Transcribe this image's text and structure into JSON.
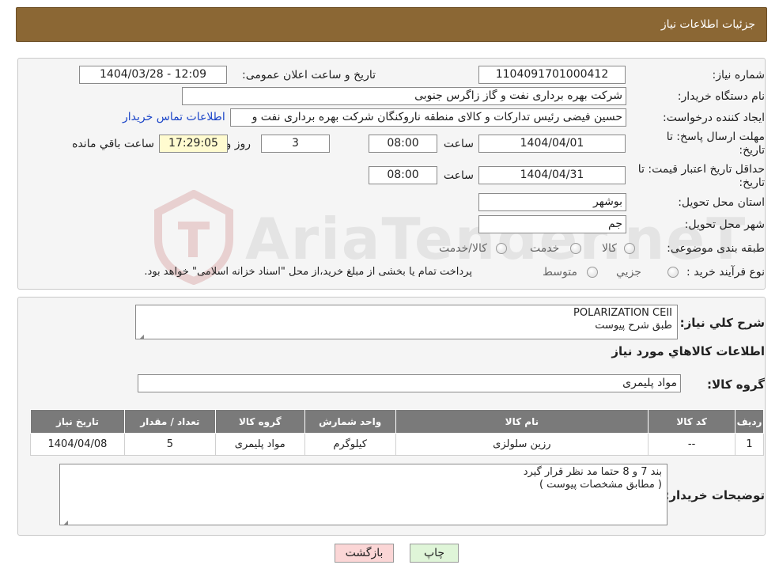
{
  "header": {
    "title": "جزئیات اطلاعات نیاز"
  },
  "fields": {
    "need_number_label": "شماره نیاز:",
    "need_number": "1104091701000412",
    "announce_label": "تاریخ و ساعت اعلان عمومی:",
    "announce_value": "1404/03/28 - 12:09",
    "buyer_org_label": "نام دستگاه خریدار:",
    "buyer_org": "شرکت بهره برداری نفت و گاز زاگرس جنوبی",
    "requester_label": "ایجاد کننده درخواست:",
    "requester": "حسین فیضی رئیس تدارکات و کالای منطقه ناروکنگان شرکت بهره برداری نفت و",
    "buyer_contact_link": "اطلاعات تماس خریدار",
    "deadline_label": "مهلت ارسال پاسخ: تا تاریخ:",
    "deadline_date": "1404/04/01",
    "time_label": "ساعت",
    "deadline_time": "08:00",
    "days_value": "3",
    "days_label": "روز و",
    "remaining_time": "17:29:05",
    "remaining_label": "ساعت باقي مانده",
    "validity_label": "حداقل تاریخ اعتبار قیمت: تا تاریخ:",
    "validity_date": "1404/04/31",
    "validity_time": "08:00",
    "province_label": "استان محل تحویل:",
    "province": "بوشهر",
    "city_label": "شهر محل تحویل:",
    "city": "جم",
    "category_label": "طبقه بندی موضوعی:",
    "category_options": [
      "کالا",
      "خدمت",
      "کالا/خدمت"
    ],
    "process_label": "نوع فرآیند خرید :",
    "process_options": [
      "جزیي",
      "متوسط"
    ],
    "process_note": "پرداخت تمام یا بخشی از مبلغ خرید،از محل \"اسناد خزانه اسلامی\" خواهد بود."
  },
  "description": {
    "label": "شرح كلي نياز:",
    "line1": "POLARIZATION CEII",
    "line2": "طبق شرح پیوست"
  },
  "goods": {
    "section_title": "اطلاعات كالاهاي مورد نياز",
    "group_label": "گروه کالا:",
    "group_value": "مواد پلیمری",
    "columns": [
      "رديف",
      "کد کالا",
      "نام کالا",
      "واحد شمارش",
      "گروه کالا",
      "تعداد / مقدار",
      "تاریخ نیاز"
    ],
    "rows": [
      [
        "1",
        "--",
        "رزین سلولزی",
        "کیلوگرم",
        "مواد پلیمری",
        "5",
        "1404/04/08"
      ]
    ]
  },
  "buyer_notes": {
    "label": "توضیحات خریدار:",
    "line1": "بند  7   و 8  حتما مد نظر قرار گیرد",
    "line2": "( مطابق مشخصات پیوست )"
  },
  "buttons": {
    "back": "بازگشت",
    "print": "چاپ"
  },
  "watermark": {
    "text": "AriaTender.neT",
    "icon": "aria-tender-logo-icon"
  }
}
